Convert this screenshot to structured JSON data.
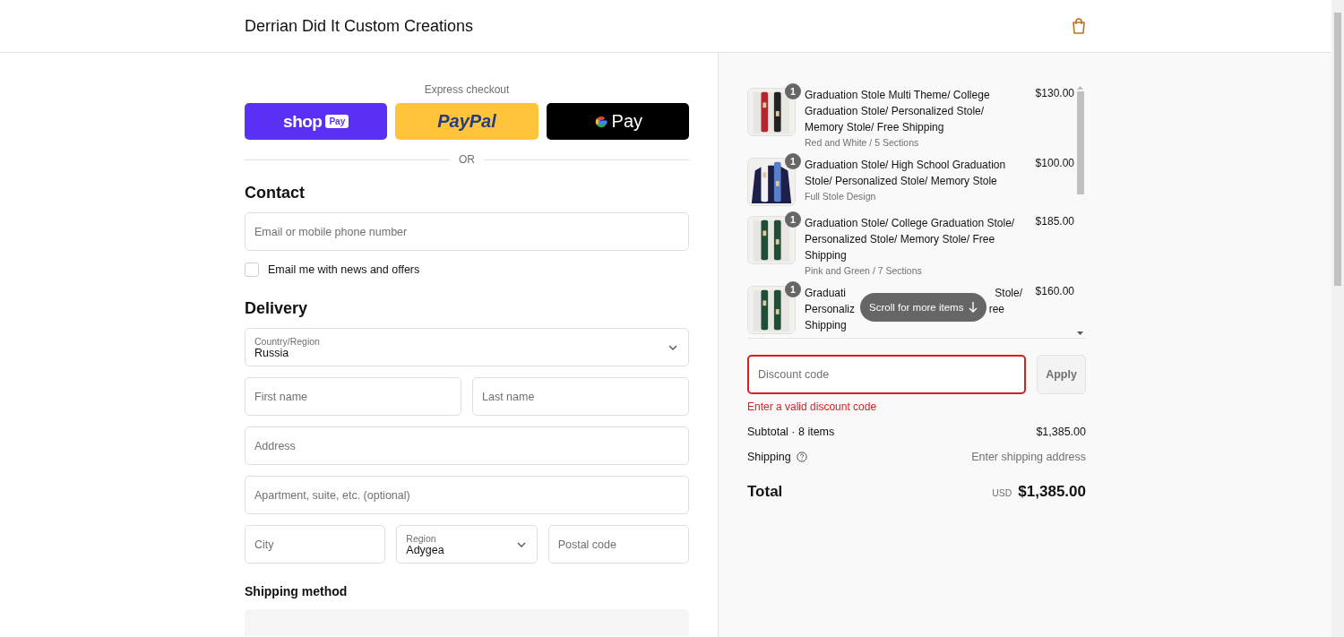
{
  "header": {
    "store_name": "Derrian Did It Custom Creations"
  },
  "express_checkout": {
    "title": "Express checkout",
    "buttons": [
      {
        "kind": "shop_pay",
        "label": "shop",
        "badge": "Pay"
      },
      {
        "kind": "paypal",
        "label": "PayPal"
      },
      {
        "kind": "gpay",
        "label": "Pay"
      }
    ],
    "divider": "OR"
  },
  "contact": {
    "heading": "Contact",
    "email": {
      "placeholder": "Email or mobile phone number"
    },
    "newsletter": {
      "label": "Email me with news and offers",
      "checked": false
    }
  },
  "delivery": {
    "heading": "Delivery",
    "country": {
      "label": "Country/Region",
      "value": "Russia"
    },
    "first_name": {
      "placeholder": "First name"
    },
    "last_name": {
      "placeholder": "Last name"
    },
    "address": {
      "placeholder": "Address"
    },
    "apartment": {
      "placeholder": "Apartment, suite, etc. (optional)"
    },
    "city": {
      "placeholder": "City"
    },
    "region": {
      "label": "Region",
      "value": "Adygea"
    },
    "postal_code": {
      "placeholder": "Postal code"
    }
  },
  "shipping_method": {
    "heading": "Shipping method"
  },
  "order_summary": {
    "items": [
      {
        "quantity": "1",
        "title": "Graduation Stole Multi Theme/ College Graduation Stole/ Personalized Stole/ Memory Stole/ Free Shipping",
        "variant": "Red and White / 5 Sections",
        "price": "$130.00"
      },
      {
        "quantity": "1",
        "title": "Graduation Stole/ High School Graduation Stole/ Personalized Stole/ Memory Stole",
        "variant": "Full Stole Design",
        "price": "$100.00"
      },
      {
        "quantity": "1",
        "title": "Graduation Stole/ College Graduation Stole/ Personalized Stole/ Memory Stole/ Free Shipping",
        "variant": "Pink and Green / 7 Sections",
        "price": "$185.00"
      },
      {
        "quantity": "1",
        "title_lines": [
          [
            "Graduati",
            "Stole/"
          ],
          [
            "Personaliz",
            "ree"
          ],
          [
            "Shipping"
          ]
        ],
        "price": "$160.00"
      }
    ],
    "scroll_hint": "Scroll for more items",
    "discount": {
      "placeholder": "Discount code",
      "error": "Enter a valid discount code",
      "invalid": true,
      "button": "Apply"
    },
    "subtotal": {
      "label": "Subtotal · 8 items",
      "value": "$1,385.00"
    },
    "shipping": {
      "label": "Shipping",
      "value": "Enter shipping address"
    },
    "total": {
      "label": "Total",
      "currency": "USD",
      "value": "$1,385.00"
    }
  }
}
